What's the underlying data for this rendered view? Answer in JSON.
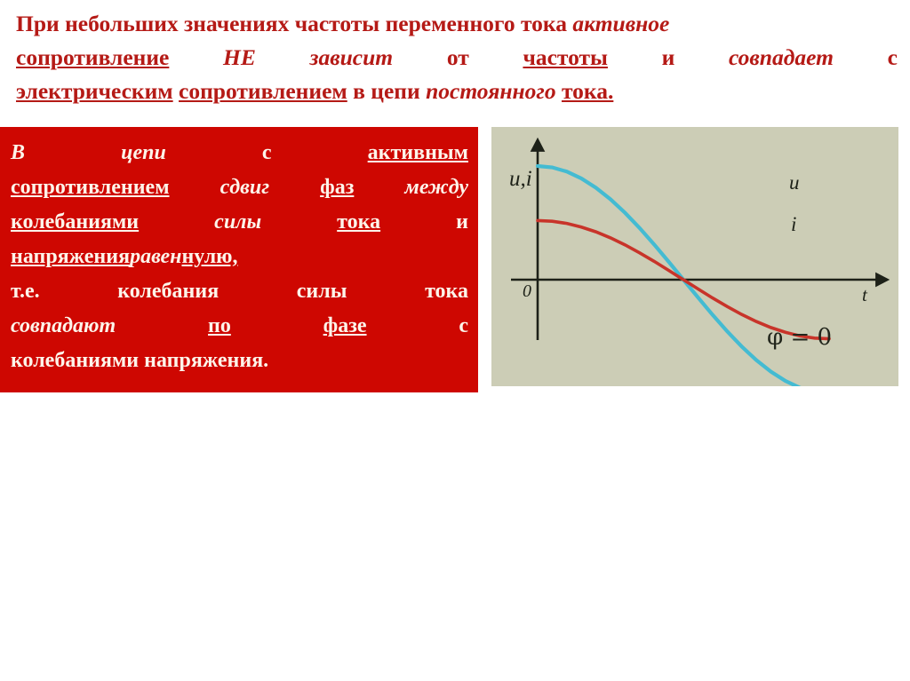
{
  "heading": {
    "line1": [
      {
        "t": "При небольших значениях частоты переменного тока ",
        "style": "plain"
      },
      {
        "t": "активное",
        "style": "italic"
      }
    ],
    "line2": [
      {
        "t": "сопротивление",
        "style": "underline"
      },
      {
        "t": "НЕ",
        "style": "italic"
      },
      {
        "t": "зависит",
        "style": "italic"
      },
      {
        "t": "от",
        "style": "plain"
      },
      {
        "t": "частоты",
        "style": "underline"
      },
      {
        "t": "и",
        "style": "plain"
      },
      {
        "t": "совпадает",
        "style": "italic"
      },
      {
        "t": "с",
        "style": "plain"
      }
    ],
    "line3": [
      {
        "t": "электрическим",
        "style": "underline"
      },
      {
        "t": "сопротивлением",
        "style": "underline"
      },
      {
        "t": "в цепи",
        "style": "plain"
      },
      {
        "t": "постоянного",
        "style": "italic"
      },
      {
        "t": "тока.",
        "style": "underline"
      }
    ],
    "color": "#B51A16"
  },
  "red_box": {
    "background": "#CE0701",
    "text_color": "#FDF4EA",
    "line1": [
      {
        "t": "В",
        "style": "italic"
      },
      {
        "t": "цепи",
        "style": "italic"
      },
      {
        "t": "с",
        "style": "plain"
      },
      {
        "t": "активным",
        "style": "underline"
      }
    ],
    "line2": [
      {
        "t": "сопротивлением",
        "style": "underline"
      },
      {
        "t": "сдвиг",
        "style": "italic"
      },
      {
        "t": "фаз",
        "style": "underline"
      },
      {
        "t": "между",
        "style": "italic"
      }
    ],
    "line3": [
      {
        "t": "колебаниями",
        "style": "underline"
      },
      {
        "t": "силы",
        "style": "italic"
      },
      {
        "t": "тока",
        "style": "underline"
      },
      {
        "t": "и",
        "style": "plain"
      }
    ],
    "line4": [
      {
        "t": "напряжения",
        "style": "underline"
      },
      {
        "t": "равен",
        "style": "italic"
      },
      {
        "t": "нулю,",
        "style": "underline"
      }
    ],
    "line5": [
      {
        "t": "т.е.",
        "style": "plain"
      },
      {
        "t": "колебания",
        "style": "plain"
      },
      {
        "t": "силы",
        "style": "plain"
      },
      {
        "t": "тока",
        "style": "plain"
      }
    ],
    "line6": [
      {
        "t": "совпадают",
        "style": "italic"
      },
      {
        "t": "по",
        "style": "underline"
      },
      {
        "t": "фазе",
        "style": "underline"
      },
      {
        "t": "с",
        "style": "plain"
      }
    ],
    "line7": [
      {
        "t": "колебаниями напряжения.",
        "style": "plain"
      }
    ]
  },
  "chart_data": {
    "type": "line",
    "title": "",
    "background": "#CCCDB6",
    "xlabel": "t",
    "ylabel": "u,i",
    "origin_label": "0",
    "annotation": "φ = 0",
    "axis_color": "#1D2118",
    "grid": false,
    "legend_position": "inline-right",
    "xlim": [
      0,
      1.06
    ],
    "ylim": [
      -1.12,
      1.12
    ],
    "x": [
      0,
      0.05,
      0.1,
      0.15,
      0.2,
      0.25,
      0.3,
      0.35,
      0.4,
      0.45,
      0.5,
      0.55,
      0.6,
      0.65,
      0.7,
      0.75,
      0.8,
      0.85,
      0.9,
      0.95,
      1.0
    ],
    "series": [
      {
        "name": "u",
        "label": "u",
        "color": "#44BBD2",
        "amplitude": 1.0,
        "phase_deg": 0,
        "values": [
          1.0,
          0.988,
          0.951,
          0.891,
          0.809,
          0.707,
          0.588,
          0.454,
          0.309,
          0.156,
          0.0,
          -0.156,
          -0.309,
          -0.454,
          -0.588,
          -0.707,
          -0.809,
          -0.891,
          -0.951,
          -0.988,
          -1.0
        ]
      },
      {
        "name": "i",
        "label": "i",
        "color": "#C8342A",
        "amplitude": 0.52,
        "phase_deg": 0,
        "values": [
          0.52,
          0.514,
          0.495,
          0.463,
          0.421,
          0.368,
          0.306,
          0.236,
          0.161,
          0.081,
          0.0,
          -0.081,
          -0.161,
          -0.236,
          -0.306,
          -0.368,
          -0.421,
          -0.463,
          -0.495,
          -0.514,
          -0.52
        ]
      }
    ]
  }
}
